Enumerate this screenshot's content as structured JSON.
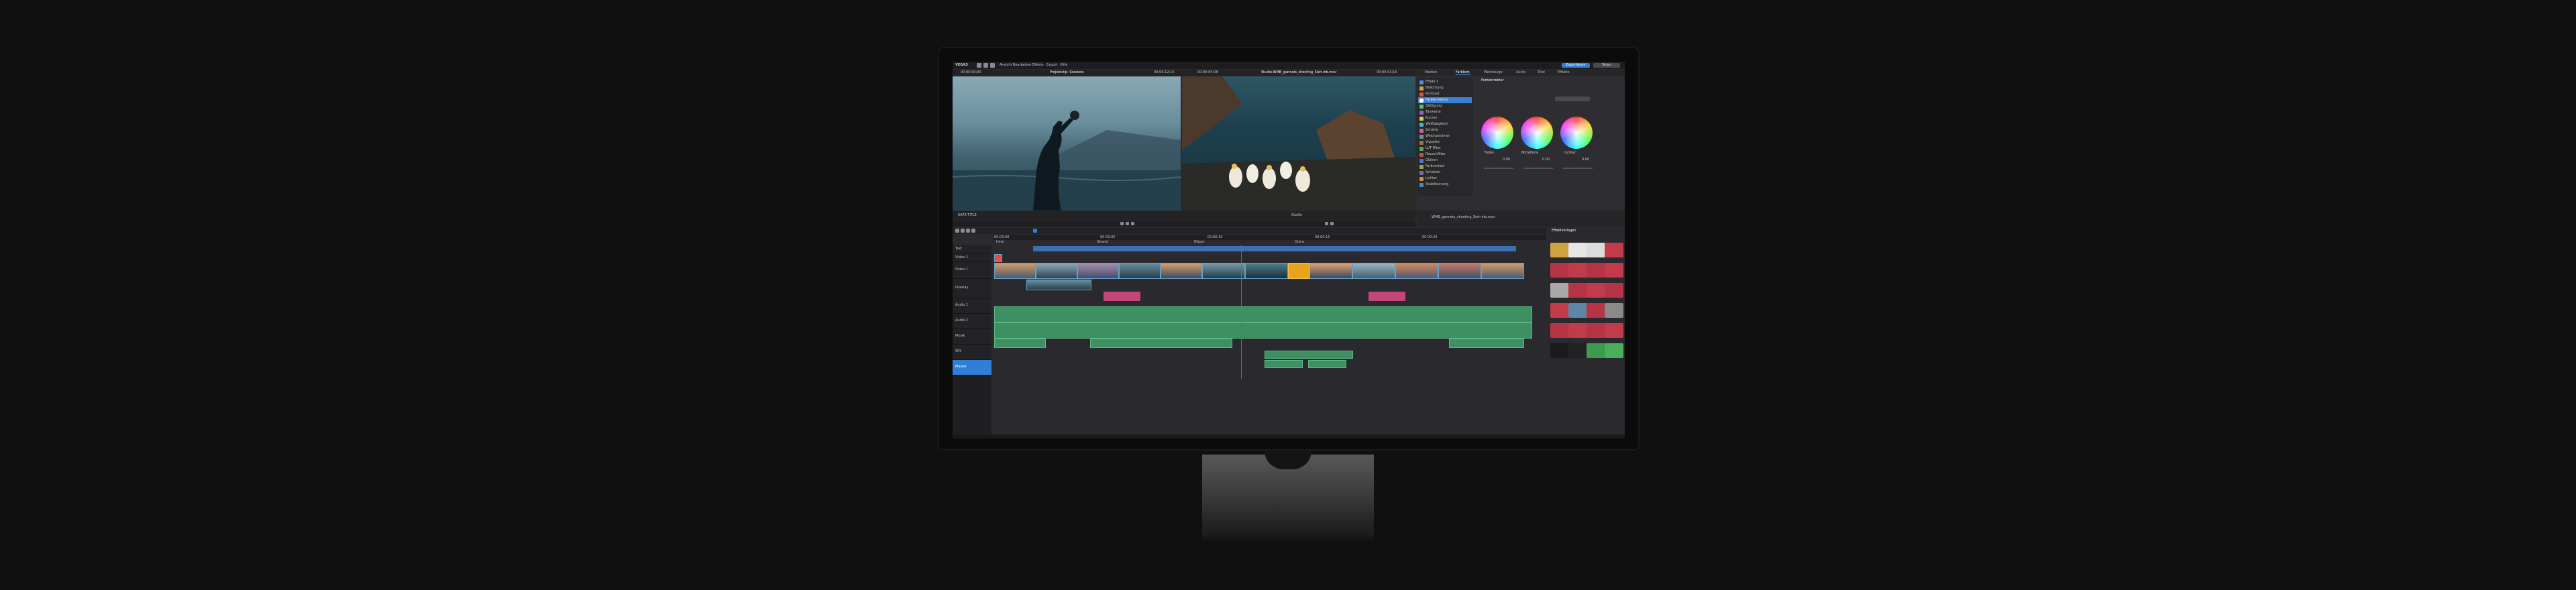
{
  "app": {
    "name": "VEGAS",
    "menus": [
      "Ansicht",
      "Bearbeiten",
      "Effekte",
      "Export",
      "Hilfe"
    ],
    "primary_button": "Exportieren",
    "secondary_button": "Teilen"
  },
  "viewers": {
    "left": {
      "timecode_start": "00:00:00;00",
      "title": "Projektclip: Sessions",
      "timecode_end": "00:00:12;15",
      "footer": "SAFE TITLE"
    },
    "right": {
      "timecode_start": "00:00:05;08",
      "title": "Studio-WMB_gannets_shooting_Sieh-inb.mov",
      "timecode_end": "00:00:03;16",
      "footer": "Quelle"
    }
  },
  "inspector": {
    "tabs": [
      "Medien",
      "Farbkorr.",
      "Werkzeuge",
      "Audio",
      "Titel",
      "Effekte"
    ],
    "active_tab": "Farbkorr.",
    "section_title": "Farbkorrektur",
    "effects_list": [
      {
        "label": "Effekt 1",
        "color": "#4f8fe0"
      },
      {
        "label": "Belichtung",
        "color": "#e0a040"
      },
      {
        "label": "Kontrast",
        "color": "#e05050"
      },
      {
        "label": "Farbkorrektur",
        "color": "#3b7fd1"
      },
      {
        "label": "Sättigung",
        "color": "#50c070"
      },
      {
        "label": "Tonwerte",
        "color": "#9060d0"
      },
      {
        "label": "Kurven",
        "color": "#d0d050"
      },
      {
        "label": "Weißabgleich",
        "color": "#50b0d0"
      },
      {
        "label": "Schärfe",
        "color": "#d06090"
      },
      {
        "label": "Weichzeichner",
        "color": "#7090a0"
      },
      {
        "label": "Vignette",
        "color": "#a07050"
      },
      {
        "label": "LUT-Filter",
        "color": "#60a060"
      },
      {
        "label": "Rauschfilter",
        "color": "#c05050"
      },
      {
        "label": "Glühen",
        "color": "#5070d0"
      },
      {
        "label": "Farbverlauf",
        "color": "#a0a050"
      },
      {
        "label": "Schatten",
        "color": "#7070a0"
      },
      {
        "label": "Lichter",
        "color": "#d09040"
      },
      {
        "label": "Stabilisierung",
        "color": "#4090c0"
      }
    ],
    "wheels": [
      {
        "label": "Tiefen",
        "value": "0.00"
      },
      {
        "label": "Mitteltöne",
        "value": "0.00"
      },
      {
        "label": "Lichter",
        "value": "0.00"
      }
    ],
    "file_path": "WMB_gannets_shooting_Sieh-inb.mov"
  },
  "timeline": {
    "ruler_labels": [
      "00:00:00",
      "00:00:05",
      "00:00:10",
      "00:00:15",
      "00:00:20"
    ],
    "region_labels": [
      "Intro",
      "Strand",
      "Klippe",
      "Outro"
    ],
    "track_labels": [
      "Text",
      "Video 2",
      "Video 1",
      "Overlay",
      "Audio 1",
      "Audio 2",
      "Musik",
      "SFX",
      "Master"
    ]
  },
  "effects_panel": {
    "title": "Effektvorlagen",
    "swatch_colors": [
      "#cfa240",
      "#e6e6e6",
      "#dcdcdc",
      "#c23b4a",
      "#b53446",
      "#c23b4a",
      "#b53446",
      "#c23b4a",
      "#a9a9a9",
      "#b53446",
      "#c23b4a",
      "#b53446",
      "#c23b4a",
      "#5e86a8",
      "#b53446",
      "#8a8a8a",
      "#b53446",
      "#c23b4a",
      "#b53446",
      "#c23b4a",
      "#1b1b1b",
      "#222",
      "#3e9a4e",
      "#49b059"
    ]
  },
  "colors": {
    "accent": "#2f7fd6",
    "video_clip": "#6aa0c8",
    "audio_clip": "#3e8f62",
    "marker": "#c2467a",
    "highlight": "#e8a41b"
  }
}
